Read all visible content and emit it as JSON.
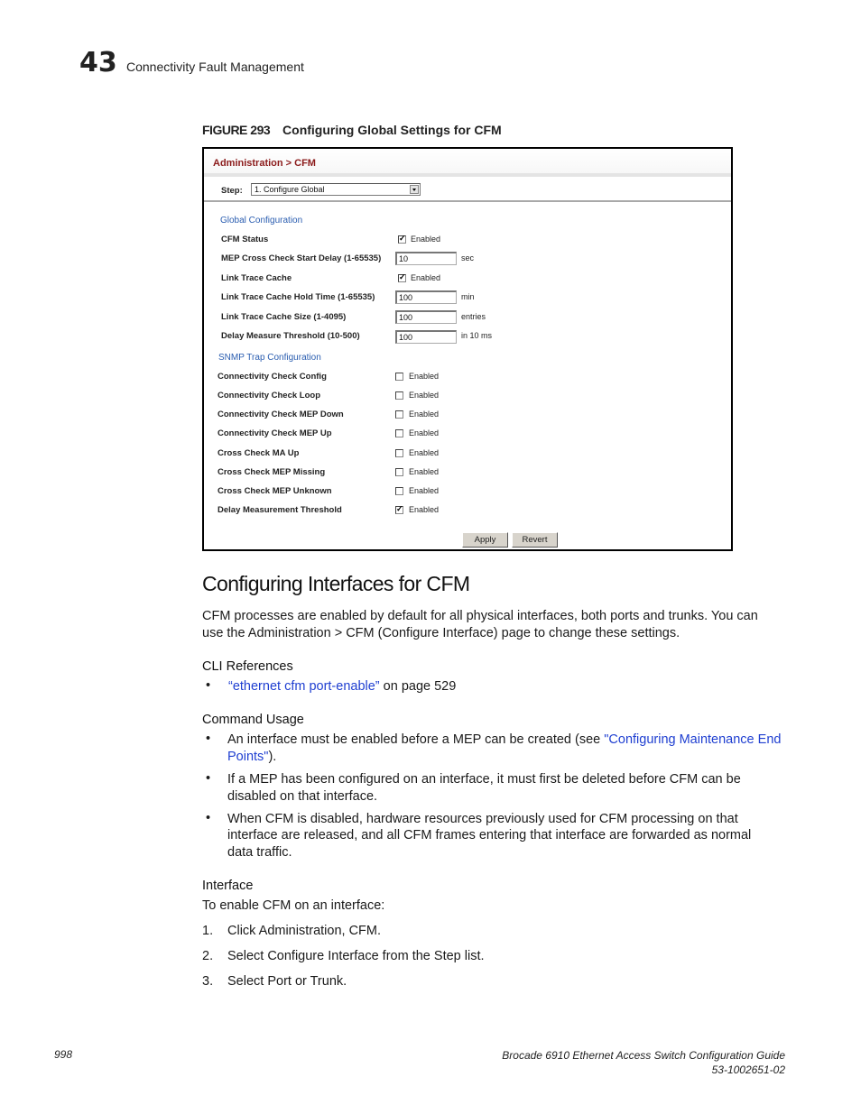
{
  "header": {
    "chapter_number": "43",
    "chapter_title": "Connectivity Fault Management"
  },
  "figure": {
    "label": "FIGURE 293",
    "caption": "Configuring Global Settings for CFM"
  },
  "panel": {
    "breadcrumb": "Administration > CFM",
    "step_label": "Step:",
    "step_value": "1. Configure Global",
    "global_section": "Global Configuration",
    "global_rows": [
      {
        "label": "CFM Status",
        "type": "checkbox",
        "checked": true,
        "value_label": "Enabled"
      },
      {
        "label": "MEP Cross Check Start Delay (1-65535)",
        "type": "text",
        "value": "10",
        "unit": "sec"
      },
      {
        "label": "Link Trace Cache",
        "type": "checkbox",
        "checked": true,
        "value_label": "Enabled"
      },
      {
        "label": "Link Trace Cache Hold Time (1-65535)",
        "type": "text",
        "value": "100",
        "unit": "min"
      },
      {
        "label": "Link Trace Cache Size (1-4095)",
        "type": "text",
        "value": "100",
        "unit": "entries"
      },
      {
        "label": "Delay Measure Threshold (10-500)",
        "type": "text",
        "value": "100",
        "unit": "in 10 ms"
      }
    ],
    "snmp_section": "SNMP Trap Configuration",
    "snmp_rows": [
      {
        "label": "Connectivity Check Config",
        "checked": false,
        "value_label": "Enabled"
      },
      {
        "label": "Connectivity Check Loop",
        "checked": false,
        "value_label": "Enabled"
      },
      {
        "label": "Connectivity Check MEP Down",
        "checked": false,
        "value_label": "Enabled"
      },
      {
        "label": "Connectivity Check MEP Up",
        "checked": false,
        "value_label": "Enabled"
      },
      {
        "label": "Cross Check MA Up",
        "checked": false,
        "value_label": "Enabled"
      },
      {
        "label": "Cross Check MEP Missing",
        "checked": false,
        "value_label": "Enabled"
      },
      {
        "label": "Cross Check MEP Unknown",
        "checked": false,
        "value_label": "Enabled"
      },
      {
        "label": "Delay Measurement Threshold",
        "checked": true,
        "value_label": "Enabled"
      }
    ],
    "apply_label": "Apply",
    "revert_label": "Revert",
    "colors": {
      "title": "#8b1a1a",
      "section": "#2a5db0"
    }
  },
  "section": {
    "title": "Configuring Interfaces for CFM",
    "intro_line1": "CFM processes are enabled by default for all physical interfaces, both ports and trunks. You can",
    "intro_line2": "use the Administration > CFM (Configure Interface) page to change these settings.",
    "cli_heading": "CLI References",
    "cli_link": "“ethernet cfm port-enable”",
    "cli_suffix": " on page 529",
    "usage_heading": "Command Usage",
    "usage_1_pre": "An interface must be enabled before a MEP can be created (see ",
    "usage_1_link_a": "\"Configuring Maintenance End",
    "usage_1_link_b": "Points\"",
    "usage_1_post": ").",
    "usage_2_line1": "If a MEP has been configured on an interface, it must first be deleted before CFM can be",
    "usage_2_line2": "disabled on that interface.",
    "usage_3_line1": "When CFM is disabled, hardware resources previously used for CFM processing on that",
    "usage_3_line2": "interface are released, and all CFM frames entering that interface are forwarded as normal",
    "usage_3_line3": "data traffic.",
    "interface_heading": "Interface",
    "interface_intro": "To enable CFM on an interface:",
    "steps": [
      {
        "num": "1.",
        "text": "Click Administration, CFM."
      },
      {
        "num": "2.",
        "text": "Select Configure Interface from the Step list."
      },
      {
        "num": "3.",
        "text": "Select Port or Trunk."
      }
    ],
    "link_color": "#1f3fd1"
  },
  "footer": {
    "page_number": "998",
    "doc_title": "Brocade 6910 Ethernet Access Switch Configuration Guide",
    "doc_number": "53-1002651-02"
  }
}
